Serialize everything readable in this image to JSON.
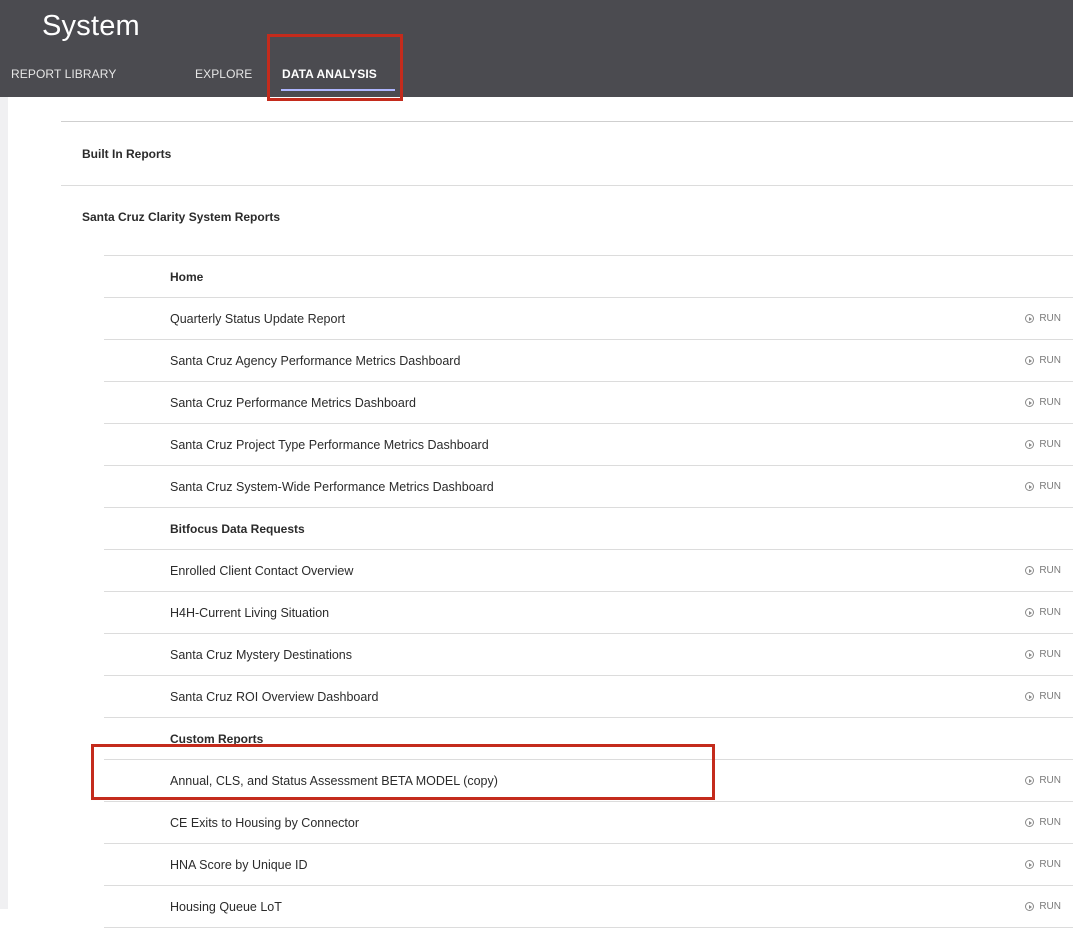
{
  "app": {
    "title": "System"
  },
  "nav": {
    "tabs": [
      {
        "label": "REPORT LIBRARY"
      },
      {
        "label": "EXPLORE"
      },
      {
        "label": "DATA ANALYSIS"
      }
    ]
  },
  "sections": {
    "built_in": "Built In Reports",
    "system_reports": "Santa Cruz Clarity System Reports"
  },
  "run_label": "RUN",
  "list": [
    {
      "name": "Home",
      "group": true
    },
    {
      "name": "Quarterly Status Update Report",
      "run": "RUN"
    },
    {
      "name": "Santa Cruz Agency Performance Metrics Dashboard",
      "run": "RUN"
    },
    {
      "name": "Santa Cruz Performance Metrics Dashboard",
      "run": "RUN"
    },
    {
      "name": "Santa Cruz Project Type Performance Metrics Dashboard",
      "run": "RUN"
    },
    {
      "name": "Santa Cruz System-Wide Performance Metrics Dashboard",
      "run": "RUN"
    },
    {
      "name": "Bitfocus Data Requests",
      "group": true
    },
    {
      "name": "Enrolled Client Contact Overview",
      "run": "RUN"
    },
    {
      "name": "H4H-Current Living Situation",
      "run": "RUN"
    },
    {
      "name": "Santa Cruz Mystery Destinations",
      "run": "RUN"
    },
    {
      "name": "Santa Cruz ROI Overview Dashboard",
      "run": "RUN"
    },
    {
      "name": "Custom Reports",
      "group": true
    },
    {
      "name": "Annual, CLS, and Status Assessment BETA MODEL (copy)",
      "run": "RUN"
    },
    {
      "name": "CE Exits to Housing by Connector",
      "run": "RUN"
    },
    {
      "name": "HNA Score by Unique ID",
      "run": "RUN"
    },
    {
      "name": "Housing Queue LoT",
      "run": "RUN"
    }
  ]
}
